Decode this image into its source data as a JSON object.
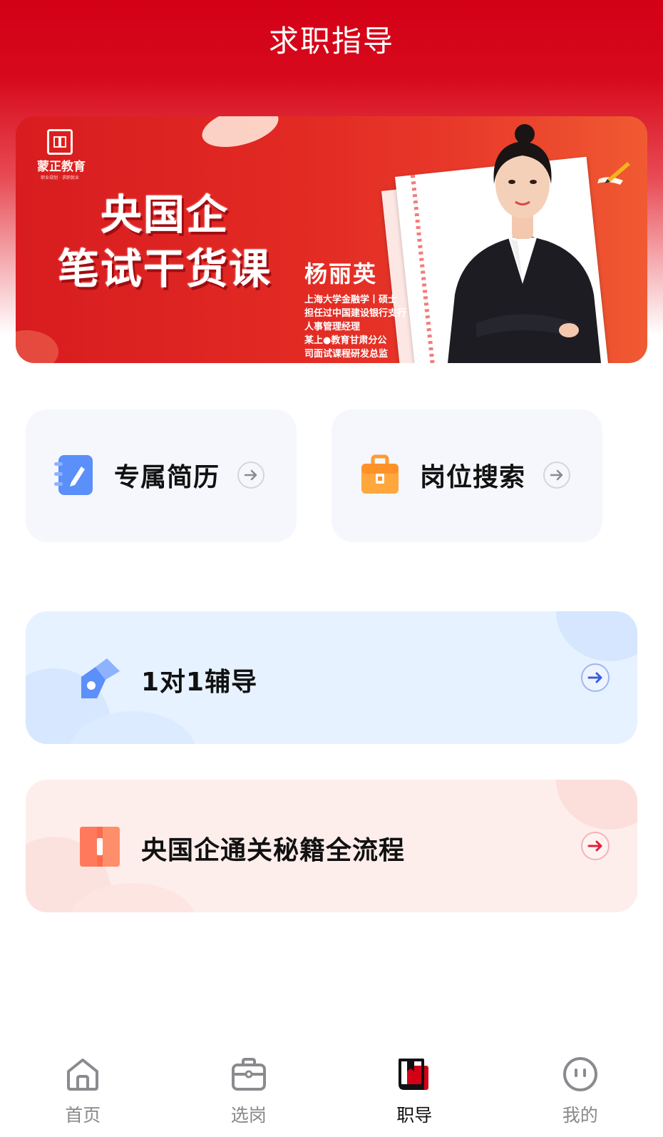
{
  "header": {
    "title": "求职指导"
  },
  "banner": {
    "logo_name": "蒙正教育",
    "logo_sub": "职业规划 · 求职就业",
    "headline_line1": "央国企",
    "headline_line2": "笔试干货课",
    "teacher_name": "杨丽英",
    "teacher_lines": [
      "上海大学金融学丨硕士",
      "担任过中国建设银行支行",
      "人事管理经理",
      "某上●教育甘肃分公",
      "司面试课程研发总监"
    ]
  },
  "cards": {
    "resume": {
      "label": "专属简历",
      "icon": "notebook-pen-icon",
      "color": "#5b8ff9"
    },
    "job_search": {
      "label": "岗位搜索",
      "icon": "briefcase-icon",
      "color": "#ff9a2e"
    },
    "tutoring": {
      "label": "1对1辅导",
      "icon": "pencil-tag-icon",
      "color": "#5b8ff9",
      "arrow_color": "#3b5bdb"
    },
    "guide": {
      "label": "央国企通关秘籍全流程",
      "icon": "open-book-icon",
      "color": "#ff6b4a",
      "arrow_color": "#e0203a"
    }
  },
  "tabbar": {
    "items": [
      {
        "label": "首页",
        "icon": "home-icon",
        "active": false
      },
      {
        "label": "选岗",
        "icon": "job-bag-icon",
        "active": false
      },
      {
        "label": "职导",
        "icon": "guide-book-icon",
        "active": true
      },
      {
        "label": "我的",
        "icon": "profile-icon",
        "active": false
      }
    ]
  },
  "colors": {
    "primary": "#d40016",
    "text": "#111111",
    "inactive": "#888888"
  }
}
